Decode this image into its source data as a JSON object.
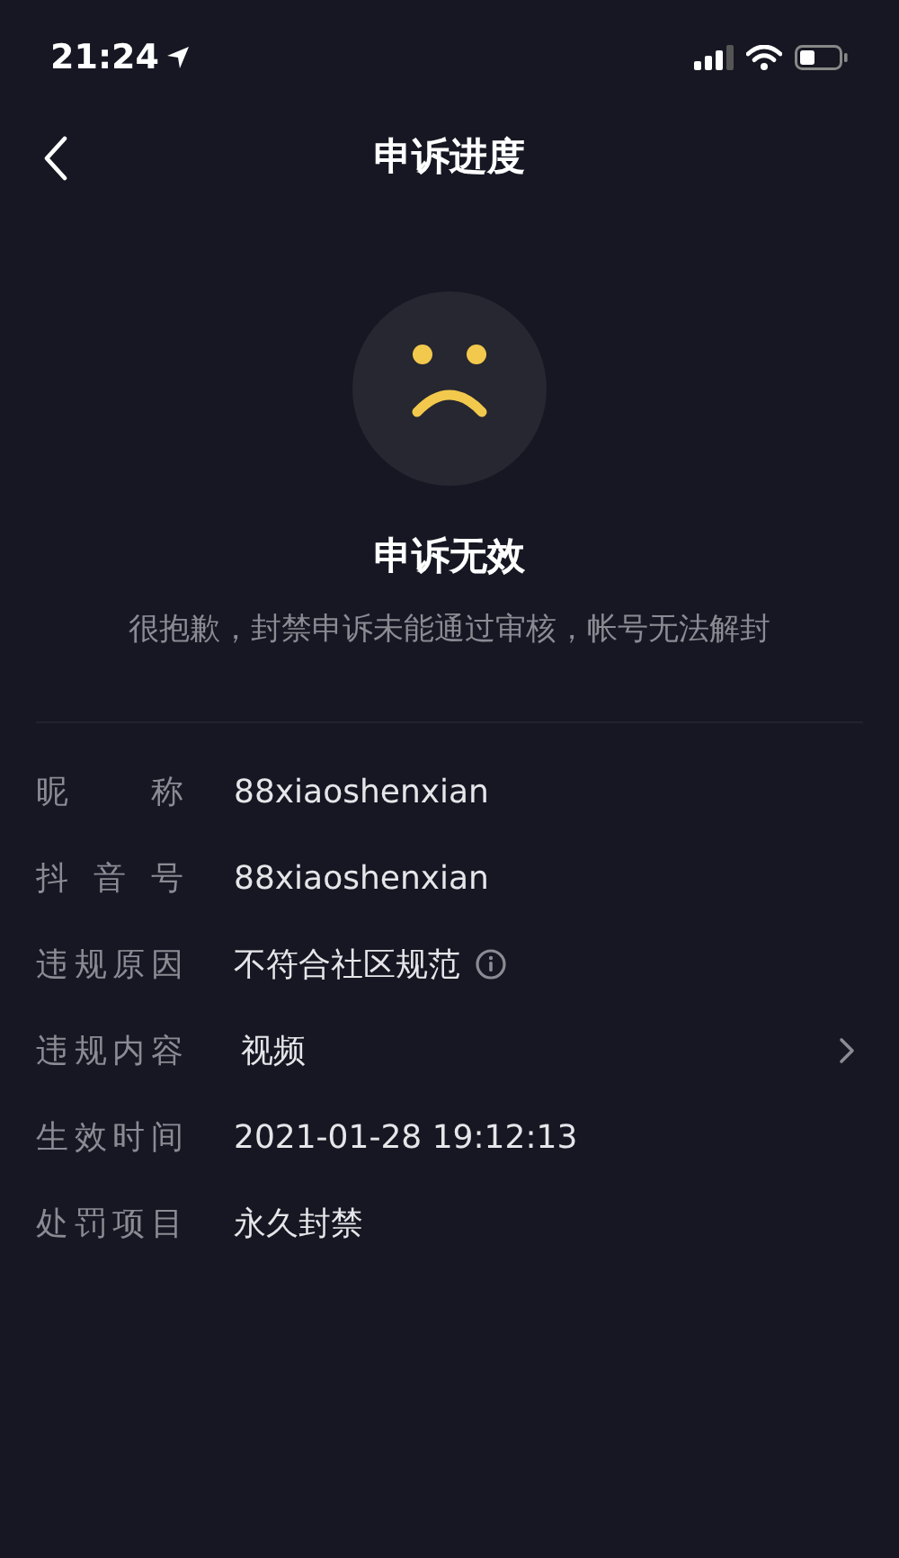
{
  "status_bar": {
    "time": "21:24"
  },
  "nav": {
    "title": "申诉进度"
  },
  "result": {
    "title": "申诉无效",
    "message": "很抱歉，封禁申诉未能通过审核，帐号无法解封"
  },
  "details": [
    {
      "label": "昵 称",
      "value": "88xiaoshenxian",
      "kind": "text"
    },
    {
      "label": "抖 音 号",
      "value": "88xiaoshenxian",
      "kind": "text"
    },
    {
      "label": "违规原因",
      "value": "不符合社区规范",
      "kind": "info"
    },
    {
      "label": "违规内容",
      "value": "视频",
      "kind": "link"
    },
    {
      "label": "生效时间",
      "value": "2021-01-28 19:12:13",
      "kind": "text"
    },
    {
      "label": "处罚项目",
      "value": "永久封禁",
      "kind": "text"
    }
  ]
}
